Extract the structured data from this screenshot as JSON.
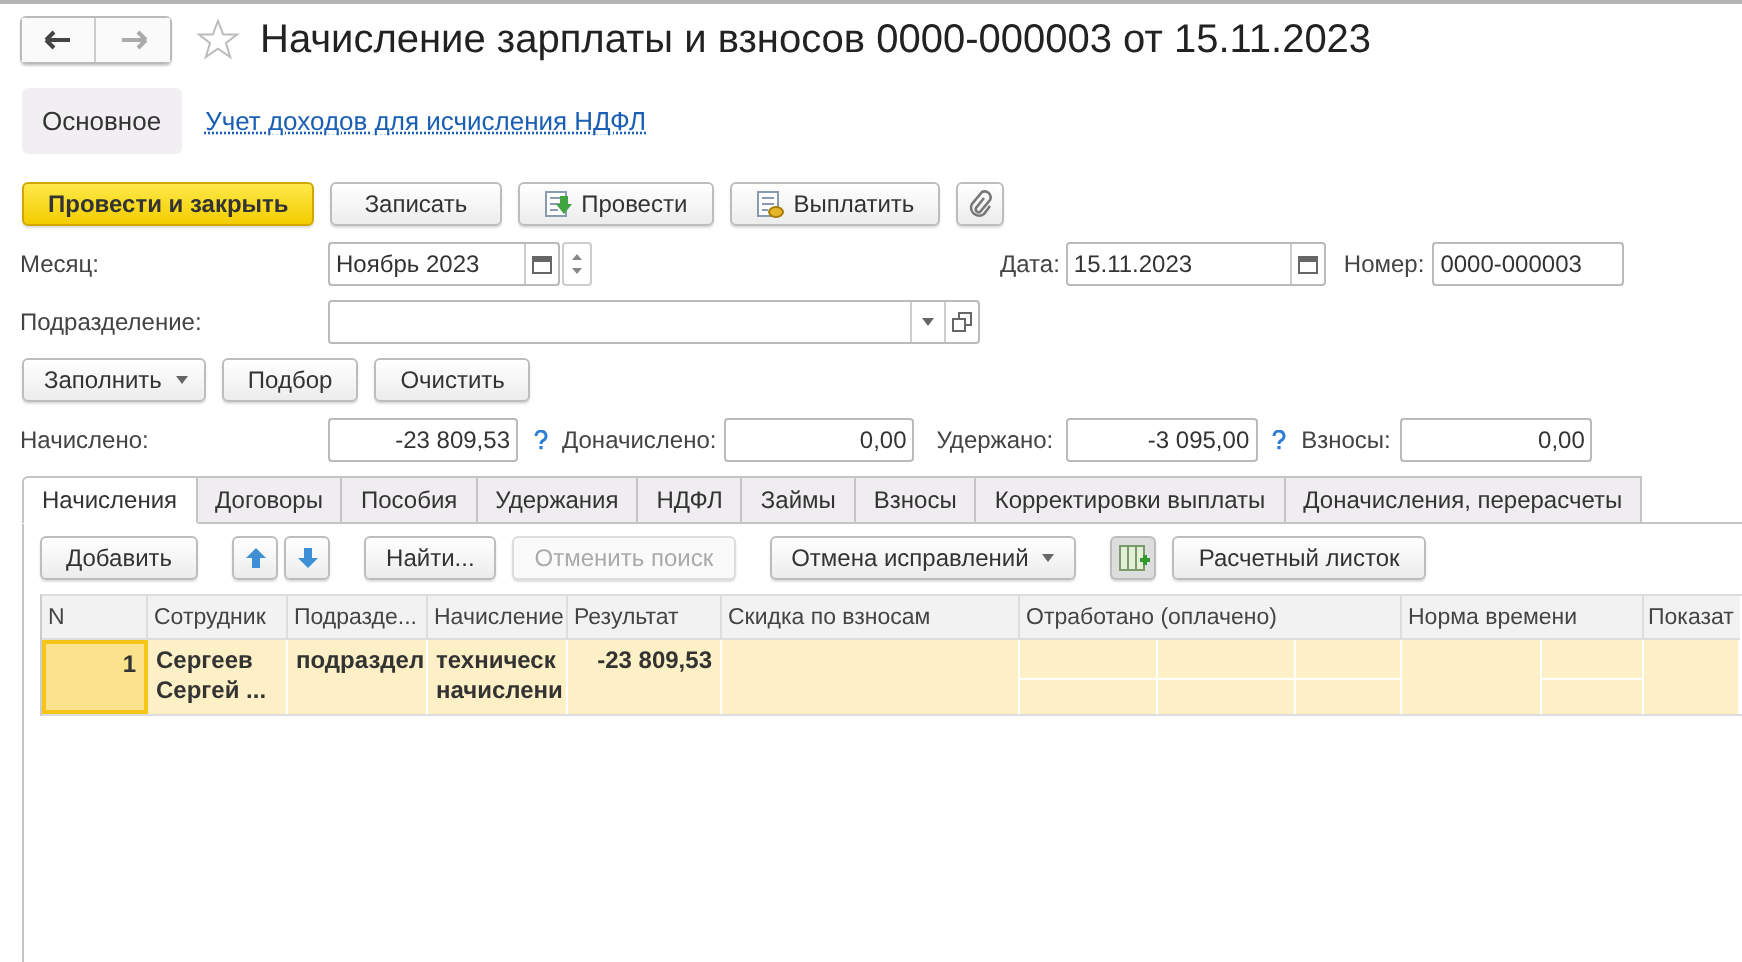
{
  "window": {
    "title": "Начисление зарплаты и взносов 0000-000003 от 15.11.2023"
  },
  "nav": [
    {
      "kind": "back",
      "disabled": false
    },
    {
      "kind": "forward",
      "disabled": true
    }
  ],
  "sections": [
    {
      "label": "Основное",
      "selected": true
    },
    {
      "label": "Учет доходов для исчисления НДФЛ",
      "selected": false
    }
  ],
  "command_bar": [
    {
      "kind": "primary",
      "label": "Провести и закрыть"
    },
    {
      "kind": "plain",
      "label": "Записать"
    },
    {
      "kind": "post",
      "label": "Провести"
    },
    {
      "kind": "pay",
      "label": "Выплатить"
    },
    {
      "kind": "attach"
    }
  ],
  "month": {
    "label": "Месяц:",
    "value": "Ноябрь 2023"
  },
  "date": {
    "label": "Дата:",
    "value": "15.11.2023"
  },
  "number": {
    "label": "Номер:",
    "value": "0000-000003"
  },
  "department": {
    "label": "Подразделение:"
  },
  "fill_buttons": [
    {
      "label": "Заполнить",
      "dropdown": true
    },
    {
      "label": "Подбор",
      "dropdown": false
    },
    {
      "label": "Очистить",
      "dropdown": false
    }
  ],
  "totals": [
    {
      "label": "Начислено:",
      "value": "-23 809,53",
      "help": true
    },
    {
      "label": "Доначислено:",
      "value": "0,00",
      "help": false
    },
    {
      "label": "Удержано:",
      "value": "-3 095,00",
      "help": true
    },
    {
      "label": "Взносы:",
      "value": "0,00",
      "help": false
    }
  ],
  "tabs": [
    {
      "label": "Начисления",
      "selected": true
    },
    {
      "label": "Договоры",
      "selected": false
    },
    {
      "label": "Пособия",
      "selected": false
    },
    {
      "label": "Удержания",
      "selected": false
    },
    {
      "label": "НДФЛ",
      "selected": false
    },
    {
      "label": "Займы",
      "selected": false
    },
    {
      "label": "Взносы",
      "selected": false
    },
    {
      "label": "Корректировки выплаты",
      "selected": false
    },
    {
      "label": "Доначисления, перерасчеты",
      "selected": false
    }
  ],
  "table_toolbar": [
    {
      "kind": "button",
      "label": "Добавить",
      "disabled": false
    },
    {
      "kind": "up"
    },
    {
      "kind": "down"
    },
    {
      "kind": "button",
      "label": "Найти...",
      "disabled": false
    },
    {
      "kind": "button",
      "label": "Отменить поиск",
      "disabled": true
    },
    {
      "kind": "dropdown",
      "label": "Отмена исправлений",
      "disabled": false
    },
    {
      "kind": "columns"
    },
    {
      "kind": "button",
      "label": "Расчетный листок",
      "disabled": false
    }
  ],
  "table": {
    "columns": [
      "N",
      "Сотрудник",
      "Подразде...",
      "Начисление",
      "Результат",
      "Скидка по взносам",
      "Отработано (оплачено)",
      "Норма времени",
      "Показат"
    ],
    "rows": [
      {
        "selected": true,
        "cells": [
          "1",
          "Сергеев Сергей ...",
          "подраздел",
          "техническ начислени",
          "-23 809,53"
        ]
      }
    ]
  }
}
